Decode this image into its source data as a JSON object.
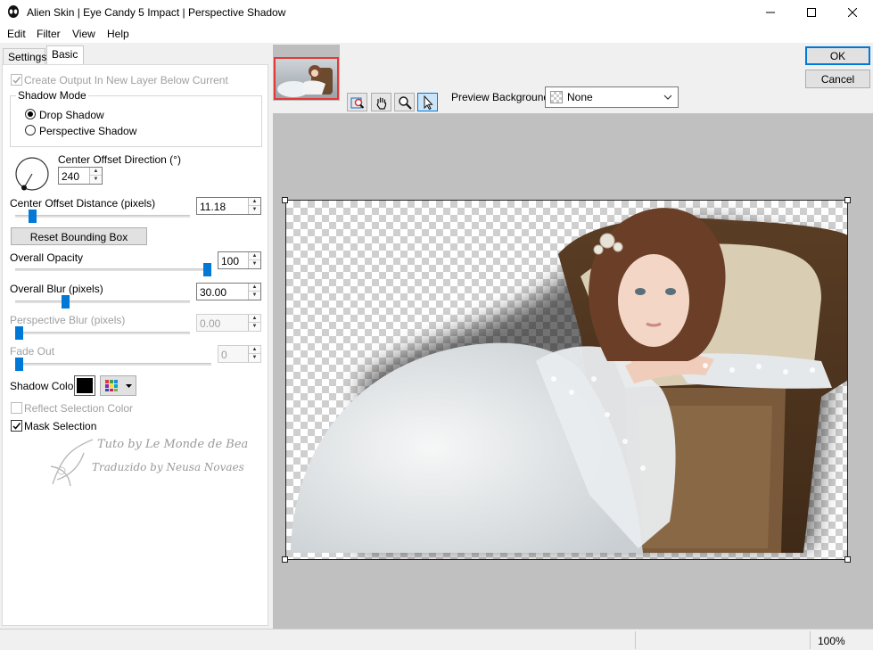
{
  "window": {
    "title": "Alien Skin | Eye Candy 5 Impact | Perspective Shadow"
  },
  "menu": [
    "Edit",
    "Filter",
    "View",
    "Help"
  ],
  "tabs": {
    "settings": "Settings",
    "basic": "Basic"
  },
  "controls": {
    "create_output_label": "Create Output In New Layer Below Current",
    "create_output_checked": true,
    "shadow_mode_label": "Shadow Mode",
    "drop_shadow_label": "Drop Shadow",
    "perspective_shadow_label": "Perspective Shadow",
    "shadow_mode_selected": "Drop Shadow",
    "center_offset_direction_label": "Center Offset Direction (°)",
    "center_offset_direction_value": "240",
    "center_offset_distance_label": "Center Offset Distance (pixels)",
    "center_offset_distance_value": "11.18",
    "center_offset_distance_level": 0.08,
    "reset_bounding_box_label": "Reset Bounding Box",
    "overall_opacity_label": "Overall Opacity",
    "overall_opacity_value": "100",
    "overall_opacity_level": 1.0,
    "overall_blur_label": "Overall Blur (pixels)",
    "overall_blur_value": "30.00",
    "overall_blur_level": 0.28,
    "perspective_blur_label": "Perspective Blur (pixels)",
    "perspective_blur_value": "0.00",
    "perspective_blur_level": 0.0,
    "fade_out_label": "Fade Out",
    "fade_out_value": "0",
    "fade_out_level": 0.0,
    "shadow_color_label": "Shadow Color",
    "shadow_color": "#000000",
    "reflect_selection_color_label": "Reflect Selection Color",
    "reflect_selection_color_checked": false,
    "mask_selection_label": "Mask Selection",
    "mask_selection_checked": true
  },
  "watermark": {
    "line1": "Tuto by Le Monde de Bea",
    "line2": "Traduzido by Neusa Novaes"
  },
  "buttons": {
    "ok": "OK",
    "cancel": "Cancel"
  },
  "preview": {
    "background_label": "Preview Background:",
    "background_value": "None",
    "tools": [
      "navigate-icon",
      "hand-icon",
      "zoom-icon",
      "pointer-icon"
    ]
  },
  "status": {
    "zoom": "100%"
  },
  "colors": {
    "accent": "#0078d7",
    "thumb_border": "#e53935"
  }
}
